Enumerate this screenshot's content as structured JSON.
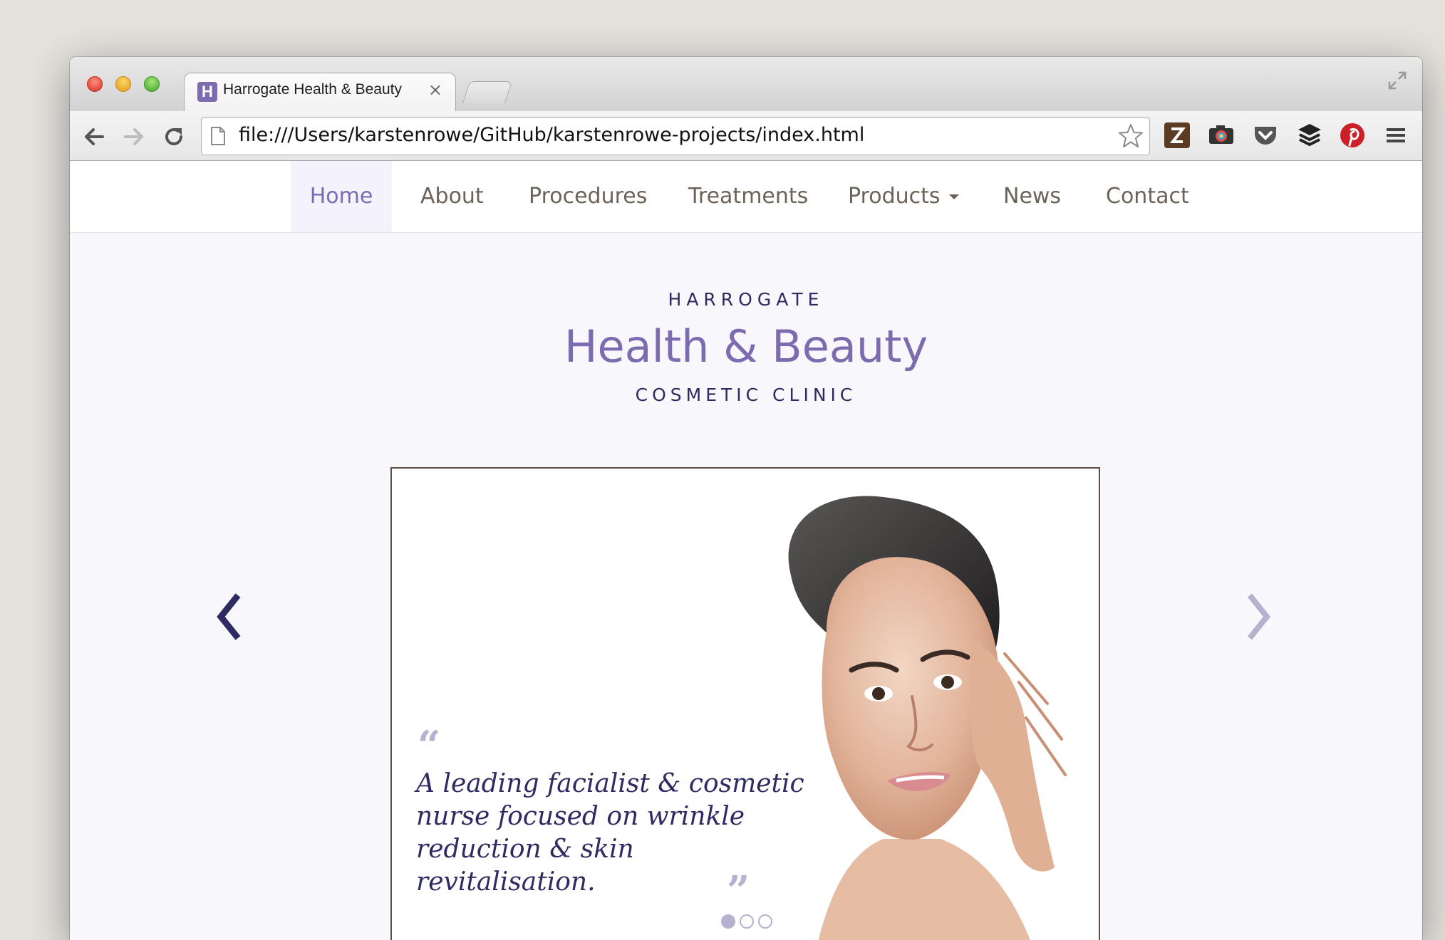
{
  "browser": {
    "tab": {
      "favicon_letter": "H",
      "title": "Harrogate Health & Beauty",
      "close_glyph": "×"
    },
    "address_bar": {
      "url": "file:///Users/karstenrowe/GitHub/karstenrowe-projects/index.html"
    },
    "icons": {
      "back": "back-arrow-icon",
      "forward": "forward-arrow-icon",
      "reload": "reload-icon",
      "bookmark": "star-icon",
      "menu": "hamburger-menu-icon"
    },
    "extensions": [
      "zotero-icon",
      "camera-icon",
      "pocket-icon",
      "buffer-icon",
      "pinterest-icon"
    ]
  },
  "site": {
    "nav": {
      "items": [
        {
          "label": "Home",
          "active": true
        },
        {
          "label": "About"
        },
        {
          "label": "Procedures"
        },
        {
          "label": "Treatments"
        },
        {
          "label": "Products",
          "dropdown": true
        },
        {
          "label": "News"
        },
        {
          "label": "Contact"
        }
      ]
    },
    "brand": {
      "top": "HARROGATE",
      "main": "Health & Beauty",
      "bottom": "COSMETIC CLINIC"
    },
    "carousel": {
      "quote_open": "“",
      "quote": "A leading facialist & cosmetic nurse focused on wrinkle reduction & skin revitalisation.",
      "quote_close": "”",
      "prev_glyph": "‹",
      "next_glyph": "›",
      "active_index": 0,
      "slide_count": 3
    }
  },
  "colors": {
    "accent": "#7d6bb0",
    "navy": "#2d2b62",
    "nav_text": "#6d6258",
    "page_bg": "#f8f7fc"
  }
}
